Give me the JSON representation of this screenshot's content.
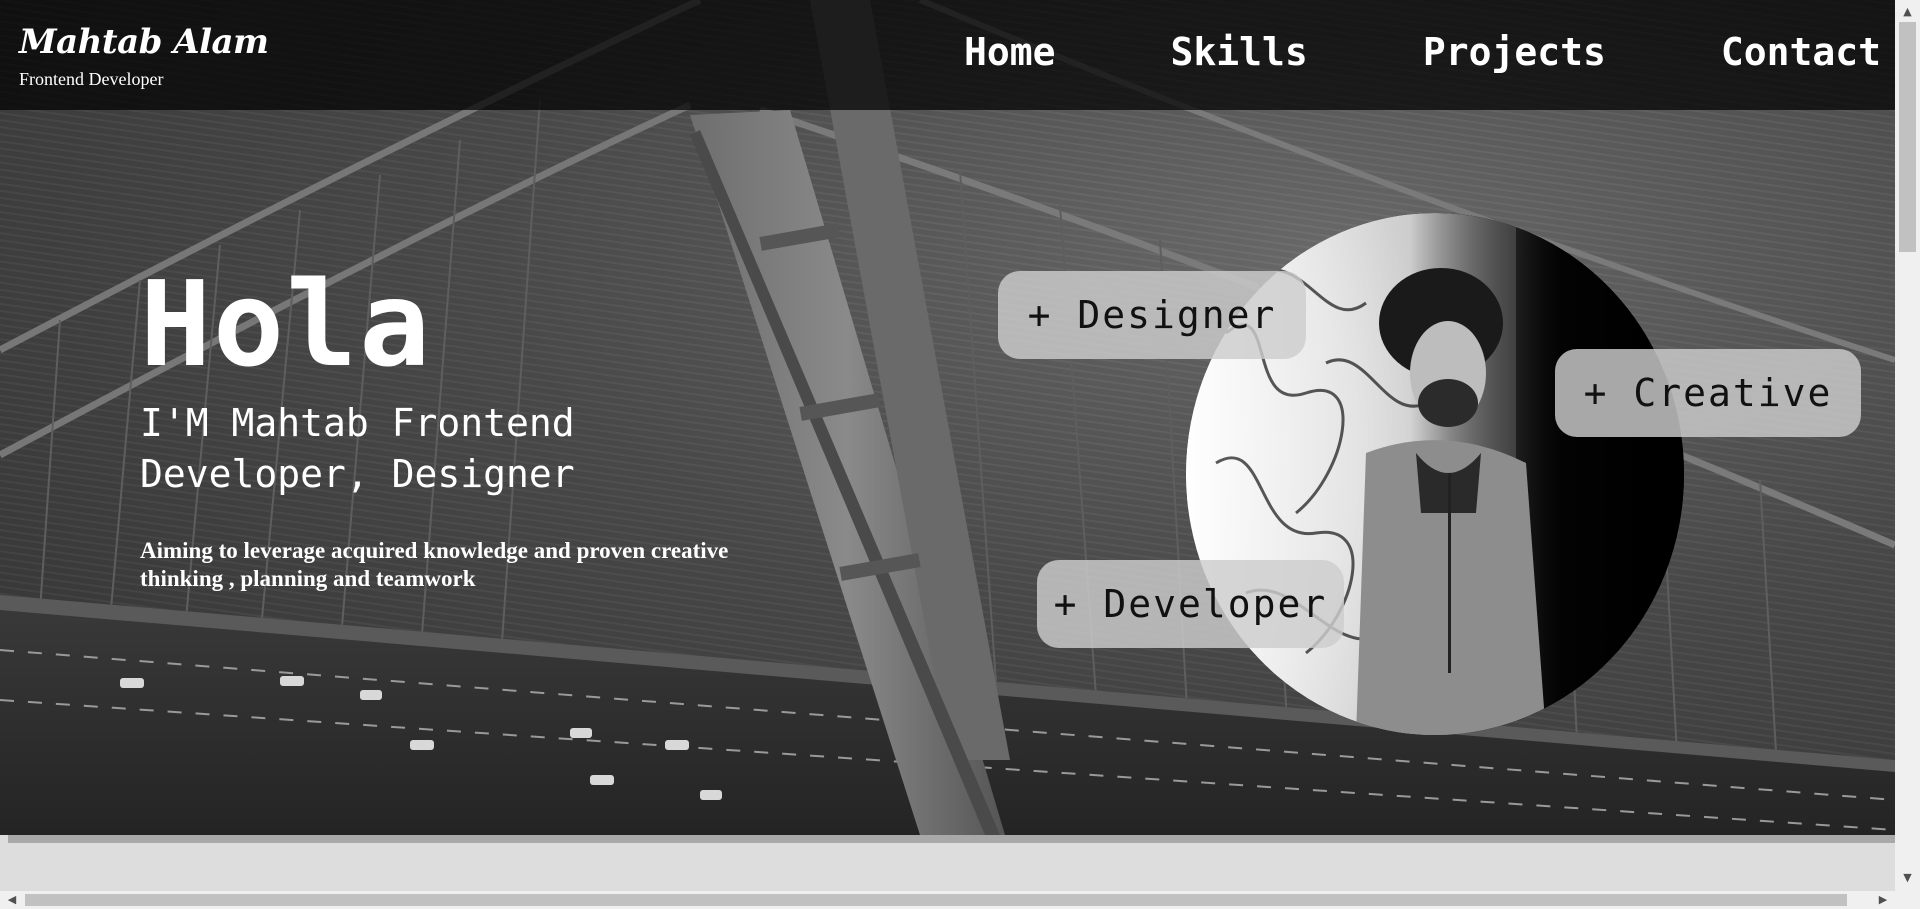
{
  "header": {
    "brand_name": "Mahtab Alam",
    "brand_subtitle": "Frontend Developer",
    "nav": [
      "Home",
      "Skills",
      "Projects",
      "Contact"
    ]
  },
  "hero": {
    "greeting": "Hola",
    "intro": "I'M Mahtab Frontend Developer, Designer",
    "aim": "Aiming to leverage acquired knowledge and proven creative thinking , planning and teamwork",
    "tags": {
      "designer": "+ Designer",
      "creative": "+ Creative",
      "developer": "+ Developer"
    }
  },
  "scrollbar_icons": {
    "up": "scroll-up-arrow",
    "down": "scroll-down-arrow",
    "left": "scroll-left-arrow",
    "right": "scroll-right-arrow"
  }
}
